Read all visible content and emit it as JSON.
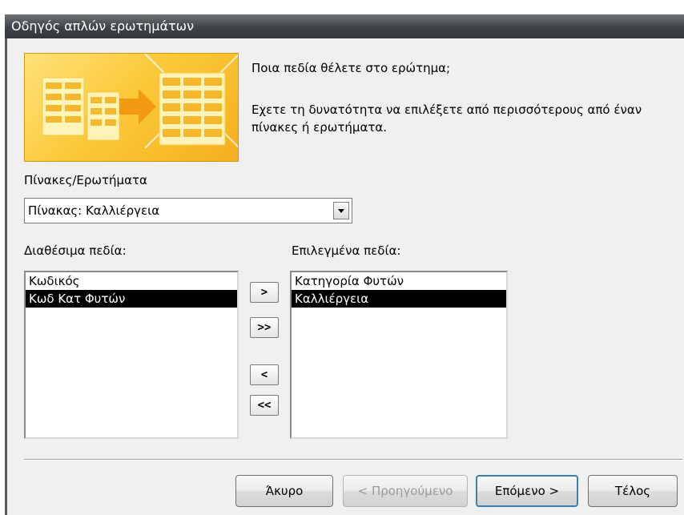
{
  "window": {
    "title": "Οδηγός απλών ερωτημάτων"
  },
  "header": {
    "question": "Ποια πεδία θέλετε στο ερώτημα;",
    "description": "Εχετε τη δυνατότητα να επιλέξετε από περισσότερους από έναν πίνακες ή ερωτήματα."
  },
  "tables": {
    "label": "Πίνακες/Ερωτήματα",
    "selected": "Πίνακας: Καλλιέργεια"
  },
  "available": {
    "label": "Διαθέσιμα πεδία:",
    "items": [
      "Κωδικός",
      "Κωδ Κατ Φυτών"
    ],
    "selected_index": 1
  },
  "chosen": {
    "label": "Επιλεγμένα πεδία:",
    "items": [
      "Κατηγορία Φυτών",
      "Καλλιέργεια"
    ],
    "selected_index": 1
  },
  "move_buttons": {
    "add_one": ">",
    "add_all": ">>",
    "remove_one": "<",
    "remove_all": "<<"
  },
  "footer": {
    "cancel": "Άκυρο",
    "back": "< Προηγούμενο",
    "next": "Επόμενο >",
    "finish": "Τέλος"
  },
  "colors": {
    "titlebar": "#3f4347",
    "selection": "#000000",
    "banner": "#fbc93a",
    "default_button_border": "#3c7fb1"
  }
}
